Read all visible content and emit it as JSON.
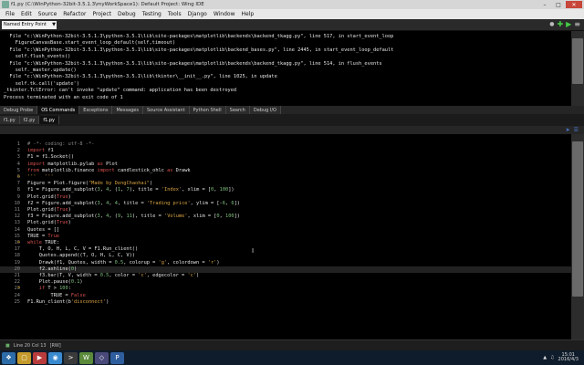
{
  "window": {
    "title": "f1.py (C:\\WinPython-32bit-3.5.1.3\\myWorkSpace1): Default Project: Wing IDE"
  },
  "menu": [
    "File",
    "Edit",
    "Source",
    "Refactor",
    "Project",
    "Debug",
    "Testing",
    "Tools",
    "Django",
    "Window",
    "Help"
  ],
  "toolstrip": {
    "stack_label": "Named Entry Point"
  },
  "output_lines": [
    "  File \"c:\\WinPython-32bit-3.5.1.3\\python-3.5.1\\lib\\site-packages\\matplotlib\\backends\\backend_tkagg.py\", line 517, in start_event_loop",
    "    FigureCanvasBase.start_event_loop_default(self,timeout)",
    "  File \"c:\\WinPython-32bit-3.5.1.3\\python-3.5.1\\lib\\site-packages\\matplotlib\\backend_bases.py\", line 2445, in start_event_loop_default",
    "    self.flush_events()",
    "  File \"c:\\WinPython-32bit-3.5.1.3\\python-3.5.1\\lib\\site-packages\\matplotlib\\backends\\backend_tkagg.py\", line 514, in flush_events",
    "    self._master.update()",
    "  File \"c:\\WinPython-32bit-3.5.1.3\\python-3.5.1\\lib\\tkinter\\__init__.py\", line 1025, in update",
    "    self.tk.call('update')",
    "_tkinter.TclError: can't invoke \"update\" command: application has been destroyed",
    "Process terminated with an exit code of 1"
  ],
  "tool_tabs": [
    "Debug Probe",
    "OS Commands",
    "Exceptions",
    "Messages",
    "Source Assistant",
    "Python Shell",
    "Search",
    "Debug I/O"
  ],
  "file_tabs": [
    "f1.py",
    "f2.py",
    "f1.py"
  ],
  "code_lines": [
    {
      "n": "1",
      "fold": "",
      "html": "<span class='cm'># -*- coding: utf-8 -*-</span>"
    },
    {
      "n": "2",
      "fold": "",
      "html": "<span class='kw'>import</span> f1"
    },
    {
      "n": "3",
      "fold": "",
      "html": "F1 = f1.Socket()"
    },
    {
      "n": "4",
      "fold": "",
      "html": "<span class='kw'>import</span> matplotlib.pylab <span class='kw'>as</span> Plot"
    },
    {
      "n": "5",
      "fold": "",
      "html": "<span class='kw'>from</span> matplotlib.finance <span class='kw'>import</span> candlestick_ohlc <span class='kw'>as</span> Drawk"
    },
    {
      "n": "6",
      "fold": "=",
      "html": "<span class='str'>'''   '''</span>"
    },
    {
      "n": "7",
      "fold": "",
      "html": "Figure = Plot.figure(<span class='str'>\"Made by DengChaohai\"</span>)"
    },
    {
      "n": "8",
      "fold": "",
      "html": "f1 = Figure.add_subplot(<span class='num'>3</span>, <span class='num'>4</span>, (<span class='num'>1</span>, <span class='num'>7</span>), title = <span class='str'>'Index'</span>, xlim = [<span class='num'>0</span>, <span class='num'>100</span>])"
    },
    {
      "n": "9",
      "fold": "",
      "html": "Plot.grid(<span class='kw'>True</span>)"
    },
    {
      "n": "10",
      "fold": "",
      "html": "f2 = Figure.add_subplot(<span class='num'>3</span>, <span class='num'>4</span>, <span class='num'>4</span>, title = <span class='str'>'Trading price'</span>, ylim = [-<span class='num'>6</span>, <span class='num'>6</span>])"
    },
    {
      "n": "11",
      "fold": "",
      "html": "Plot.grid(<span class='kw'>True</span>)"
    },
    {
      "n": "12",
      "fold": "",
      "html": "f3 = Figure.add_subplot(<span class='num'>3</span>, <span class='num'>4</span>, (<span class='num'>9</span>, <span class='num'>11</span>), title = <span class='str'>'Volume'</span>, xlim = [<span class='num'>0</span>, <span class='num'>100</span>])"
    },
    {
      "n": "13",
      "fold": "",
      "html": "Plot.grid(<span class='kw'>True</span>)"
    },
    {
      "n": "14",
      "fold": "",
      "html": "Quotes = []"
    },
    {
      "n": "15",
      "fold": "",
      "html": "TRUE = <span class='kw'>True</span>"
    },
    {
      "n": "16",
      "fold": "=",
      "html": "<span class='kw'>while</span> TRUE:"
    },
    {
      "n": "17",
      "fold": "",
      "html": "    T, O, H, L, C, V = F1.Run_client()"
    },
    {
      "n": "18",
      "fold": "",
      "html": "    Quotes.append((T, O, H, L, C, V))"
    },
    {
      "n": "19",
      "fold": "",
      "html": "    Drawk(f1, Quotes, width = <span class='num'>0.5</span>, colorup = <span class='str'>'g'</span>, colordown = <span class='str'>'r'</span>)"
    },
    {
      "n": "20",
      "fold": "",
      "html": "    f2.axhline(<span class='num'>0</span>)",
      "hl": true
    },
    {
      "n": "21",
      "fold": "",
      "html": "    f3.bar(T, V, width = <span class='num'>0.5</span>, color = <span class='str'>'c'</span>, edgecolor = <span class='str'>'c'</span>)"
    },
    {
      "n": "22",
      "fold": "",
      "html": "    Plot.pause(<span class='num'>0.1</span>)"
    },
    {
      "n": "23",
      "fold": "=",
      "html": "    <span class='kw'>if</span> T &gt; <span class='num'>100</span>:"
    },
    {
      "n": "24",
      "fold": "",
      "html": "        TRUE = <span class='kw'>False</span>"
    },
    {
      "n": "25",
      "fold": "",
      "html": "F1.Run_client(b<span class='str'>'disconnect'</span>)"
    }
  ],
  "status": {
    "position": "Line 20 Col 13",
    "mode": "[RW]"
  },
  "taskbar": {
    "time": "15:01",
    "date": "2016/4/3"
  }
}
